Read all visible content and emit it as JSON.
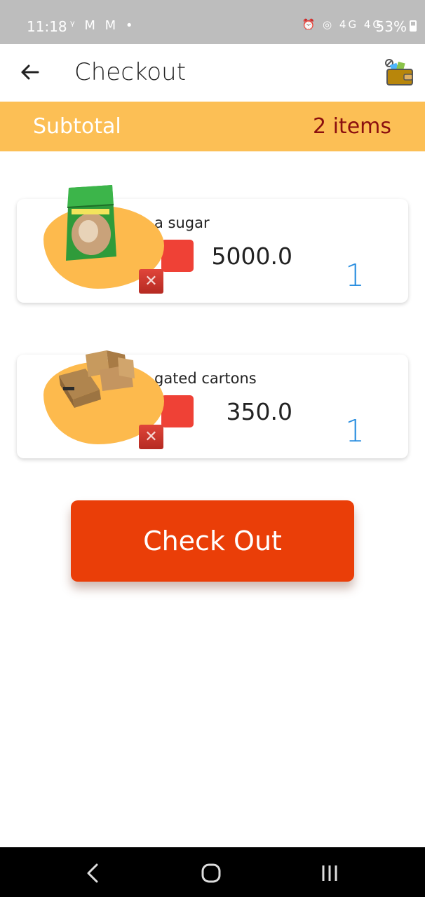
{
  "status_bar": {
    "time": "11:18",
    "left_icons": "ᵞ M M •",
    "right_icons": "⏰ ◎ 4G 4G",
    "battery": "53%"
  },
  "app_bar": {
    "title": "Checkout",
    "back_icon": "arrow-left-icon",
    "wallet_icon": "wallet-icon"
  },
  "subtotal": {
    "label": "Subtotal",
    "count": "2 items"
  },
  "cart": {
    "items": [
      {
        "name": "a sugar",
        "price": "5000.0",
        "qty": "1",
        "image": "sugar-bag"
      },
      {
        "name": "gated cartons",
        "price": "350.0",
        "qty": "1",
        "image": "cartons"
      }
    ]
  },
  "checkout_button": {
    "label": "Check Out"
  },
  "colors": {
    "accent": "#fcbf55",
    "button": "#ea3e08",
    "qty": "#2a8ee0",
    "count": "#8b0f0f"
  }
}
